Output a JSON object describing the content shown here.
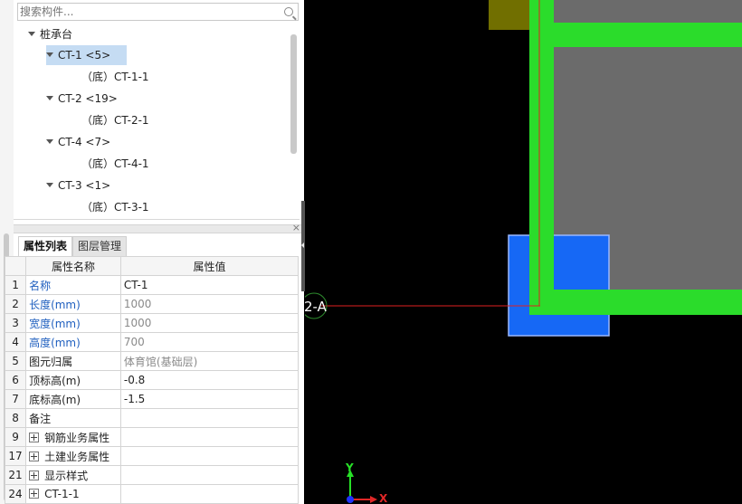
{
  "search": {
    "placeholder": "搜索构件..."
  },
  "tree": {
    "root": "桩承台",
    "groups": [
      {
        "label": "CT-1 <5>",
        "child": "（底）CT-1-1"
      },
      {
        "label": "CT-2 <19>",
        "child": "（底）CT-2-1"
      },
      {
        "label": "CT-4 <7>",
        "child": "（底）CT-4-1"
      },
      {
        "label": "CT-3 <1>",
        "child": "（底）CT-3-1"
      }
    ]
  },
  "tabs": [
    "属性列表",
    "图层管理"
  ],
  "properties": {
    "header": {
      "name": "属性名称",
      "value": "属性值"
    },
    "rows": [
      {
        "num": "1",
        "name": "名称",
        "value": "CT-1"
      },
      {
        "num": "2",
        "name": "长度(mm)",
        "value": "1000"
      },
      {
        "num": "3",
        "name": "宽度(mm)",
        "value": "1000"
      },
      {
        "num": "4",
        "name": "高度(mm)",
        "value": "700"
      },
      {
        "num": "5",
        "name": "图元归属",
        "value": "体育馆(基础层)"
      },
      {
        "num": "6",
        "name": "顶标高(m)",
        "value": "-0.8"
      },
      {
        "num": "7",
        "name": "底标高(m)",
        "value": "-1.5"
      },
      {
        "num": "8",
        "name": "备注",
        "value": ""
      },
      {
        "num": "9",
        "name": "钢筋业务属性",
        "value": ""
      },
      {
        "num": "17",
        "name": "土建业务属性",
        "value": ""
      },
      {
        "num": "21",
        "name": "显示样式",
        "value": ""
      },
      {
        "num": "24",
        "name": "CT-1-1",
        "value": ""
      }
    ]
  },
  "canvas": {
    "axis_label": "2-A",
    "y_label": "Y",
    "x_label": "X",
    "colors": {
      "beam": "#2bdc2b",
      "column": "#1668f5",
      "slab": "#6b6b6b",
      "olive": "#716f00",
      "axis": "#e02020"
    }
  }
}
